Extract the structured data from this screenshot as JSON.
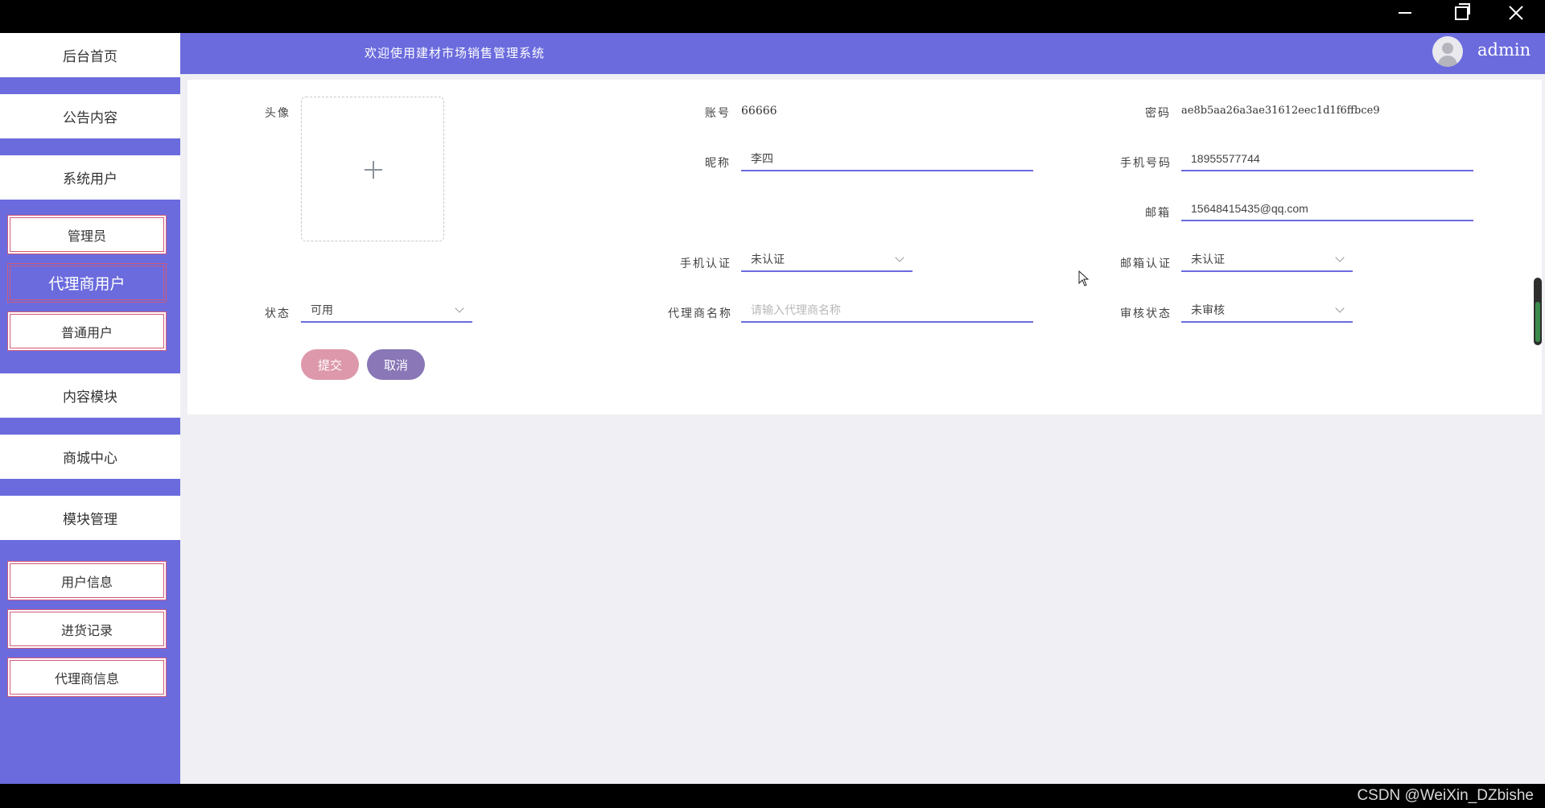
{
  "window": {
    "controls": [
      "minimize",
      "restore",
      "close"
    ]
  },
  "header": {
    "welcome": "欢迎使用建材市场销售管理系统",
    "user": "admin"
  },
  "sidebar": {
    "items": [
      {
        "label": "后台首页"
      },
      {
        "label": "公告内容"
      },
      {
        "label": "系统用户"
      },
      {
        "label": "管理员"
      },
      {
        "label": "代理商用户",
        "active": true
      },
      {
        "label": "普通用户"
      },
      {
        "label": "内容模块"
      },
      {
        "label": "商城中心"
      },
      {
        "label": "模块管理"
      },
      {
        "label": "用户信息"
      },
      {
        "label": "进货记录"
      },
      {
        "label": "代理商信息"
      }
    ]
  },
  "form": {
    "avatar_label": "头像",
    "account_label": "账号",
    "account_value": "66666",
    "password_label": "密码",
    "password_value": "ae8b5aa26a3ae31612eec1d1f6ffbce9",
    "nickname_label": "昵称",
    "nickname_value": "李四",
    "phone_label": "手机号码",
    "phone_value": "18955577744",
    "email_label": "邮箱",
    "email_value": "15648415435@qq.com",
    "phone_auth_label": "手机认证",
    "phone_auth_value": "未认证",
    "email_auth_label": "邮箱认证",
    "email_auth_value": "未认证",
    "status_label": "状态",
    "status_value": "可用",
    "agent_name_label": "代理商名称",
    "agent_name_placeholder": "请输入代理商名称",
    "review_label": "审核状态",
    "review_value": "未审核",
    "submit_label": "提交",
    "cancel_label": "取消"
  },
  "footer": {
    "watermark": "CSDN @WeiXin_DZbishe"
  },
  "colors": {
    "primary": "#6b6bde",
    "submit": "#dd98ab",
    "cancel": "#8977b7",
    "accent_border": "#d05a7a"
  }
}
